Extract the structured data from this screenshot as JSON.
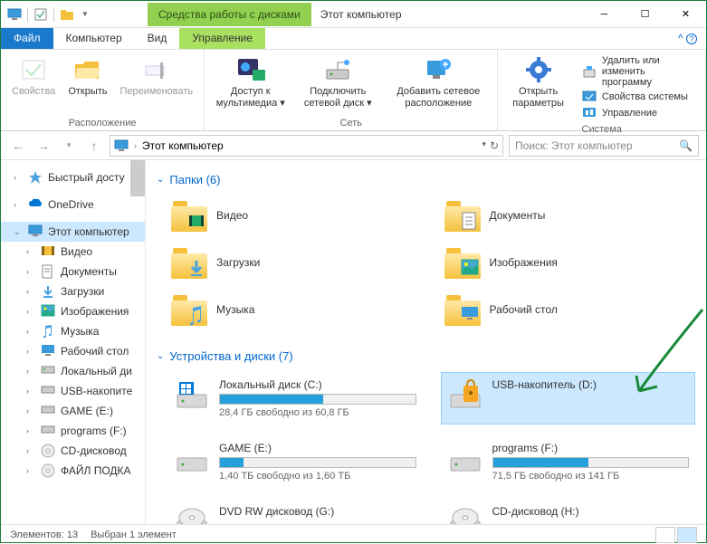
{
  "window": {
    "context_tab": "Средства работы с дисками",
    "title": "Этот компьютер"
  },
  "tabs": {
    "file": "Файл",
    "computer": "Компьютер",
    "view": "Вид",
    "manage": "Управление"
  },
  "ribbon": {
    "location": {
      "label": "Расположение",
      "properties": "Свойства",
      "open": "Открыть",
      "rename": "Переименовать"
    },
    "network": {
      "label": "Сеть",
      "media": "Доступ к мультимедиа",
      "map_drive": "Подключить сетевой диск",
      "add_location": "Добавить сетевое расположение"
    },
    "system": {
      "label": "Система",
      "settings": "Открыть параметры",
      "uninstall": "Удалить или изменить программу",
      "sys_props": "Свойства системы",
      "manage": "Управление"
    }
  },
  "addressbar": {
    "path": "Этот компьютер"
  },
  "search": {
    "placeholder": "Поиск: Этот компьютер"
  },
  "nav": {
    "quick_access": "Быстрый досту",
    "onedrive": "OneDrive",
    "this_pc": "Этот компьютер",
    "videos": "Видео",
    "documents": "Документы",
    "downloads": "Загрузки",
    "pictures": "Изображения",
    "music": "Музыка",
    "desktop": "Рабочий стол",
    "local_disk": "Локальный ди",
    "usb": "USB-накопите",
    "game": "GAME (E:)",
    "programs": "programs (F:)",
    "cd": "CD-дисковод",
    "file_podka": "ФАЙЛ ПОДКА"
  },
  "groups": {
    "folders": "Папки (6)",
    "drives": "Устройства и диски (7)"
  },
  "folders": [
    {
      "label": "Видео",
      "overlay": "video"
    },
    {
      "label": "Документы",
      "overlay": "doc"
    },
    {
      "label": "Загрузки",
      "overlay": "download"
    },
    {
      "label": "Изображения",
      "overlay": "image"
    },
    {
      "label": "Музыка",
      "overlay": "music"
    },
    {
      "label": "Рабочий стол",
      "overlay": "desktop"
    }
  ],
  "drives": [
    {
      "label": "Локальный диск (C:)",
      "info": "28,4 ГБ свободно из 60,8 ГБ",
      "fill": 53,
      "type": "hdd-win"
    },
    {
      "label": "USB-накопитель (D:)",
      "info": "",
      "fill": null,
      "type": "usb-lock",
      "selected": true
    },
    {
      "label": "GAME (E:)",
      "info": "1,40 ТБ свободно из 1,60 ТБ",
      "fill": 12,
      "type": "hdd"
    },
    {
      "label": "programs (F:)",
      "info": "71,5 ГБ свободно из 141 ГБ",
      "fill": 49,
      "type": "hdd"
    },
    {
      "label": "DVD RW дисковод (G:)",
      "info": "",
      "fill": null,
      "type": "dvd"
    },
    {
      "label": "CD-дисковод (H:)",
      "info": "",
      "fill": null,
      "type": "cd"
    }
  ],
  "status": {
    "count": "Элементов: 13",
    "selected": "Выбран 1 элемент"
  }
}
